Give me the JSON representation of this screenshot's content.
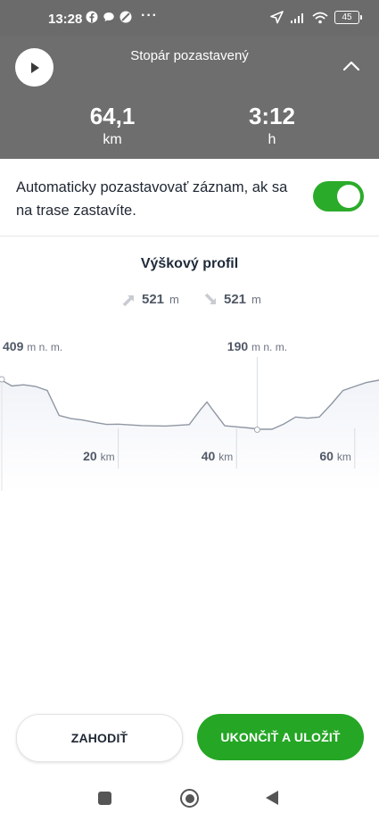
{
  "status_bar": {
    "time": "13:28",
    "dots": "···",
    "battery": "45",
    "icons": [
      "facebook-icon",
      "chat-icon",
      "compass-icon",
      "location-arrow-icon",
      "signal-icon",
      "wifi-icon",
      "battery-icon"
    ]
  },
  "header": {
    "title": "Stopár pozastavený",
    "distance_value": "64,1",
    "distance_unit": "km",
    "time_value": "3:12",
    "time_unit": "h",
    "play_icon": "play-icon",
    "collapse_icon": "chevron-up-icon"
  },
  "auto_pause": {
    "text": "Automaticky pozastavovať záznam, ak sa na trase zastavíte.",
    "enabled": true,
    "toggle_color": "#2bab2a"
  },
  "elevation": {
    "title": "Výškový profil",
    "ascent_value": "521",
    "ascent_unit": "m",
    "descent_value": "521",
    "descent_unit": "m",
    "max_label_value": "409",
    "min_label_value": "190",
    "altitude_unit": "m n. m.",
    "distance_ticks": [
      {
        "value": "20",
        "unit": "km"
      },
      {
        "value": "40",
        "unit": "km"
      },
      {
        "value": "60",
        "unit": "km"
      }
    ]
  },
  "chart_data": {
    "type": "area",
    "x_unit": "km",
    "y_unit": "m n. m.",
    "x": [
      0,
      2,
      4,
      6,
      8,
      10,
      12,
      14,
      16,
      18,
      20,
      24,
      28,
      32,
      34,
      35,
      36,
      38,
      42,
      44,
      46,
      48,
      50,
      52,
      54,
      56,
      58,
      60,
      62,
      64.1
    ],
    "y": [
      409,
      380,
      385,
      378,
      360,
      252,
      238,
      232,
      222,
      213,
      214,
      208,
      206,
      212,
      280,
      310,
      275,
      207,
      198,
      192,
      192,
      215,
      245,
      240,
      245,
      300,
      360,
      378,
      395,
      405
    ],
    "xlim": [
      0,
      64.1
    ],
    "max_point": {
      "x": 0,
      "y": 409
    },
    "min_point": {
      "x": 43.5,
      "y": 190
    },
    "area_color": "#eef1f6",
    "line_color": "#8f97a3"
  },
  "actions": {
    "discard_label": "ZAHODIŤ",
    "save_label": "UKONČIŤ A ULOŽIŤ",
    "save_color": "#25a625"
  },
  "nav": {
    "icons": [
      "recents-square-icon",
      "home-circle-icon",
      "back-triangle-icon"
    ]
  }
}
